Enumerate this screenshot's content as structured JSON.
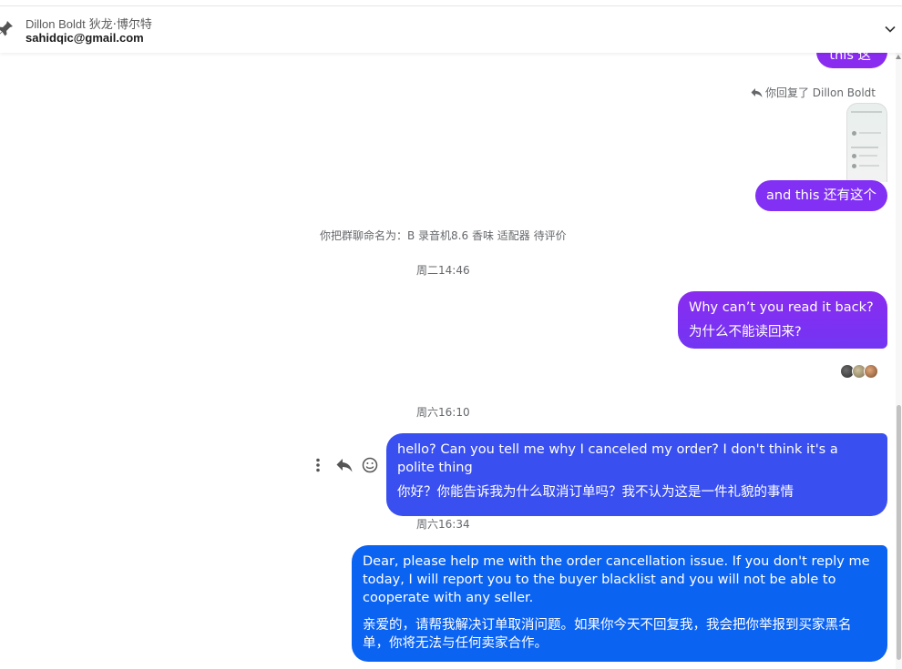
{
  "header": {
    "contact_name": "Dillon Boldt",
    "contact_name_cn": "狄龙·博尔特",
    "email": "sahidqic@gmail.com"
  },
  "thread": {
    "msg_top": "this  这",
    "reply_note": "你回复了 Dillon Boldt",
    "msg_and_this": "and this  还有这个",
    "system_rename": "你把群聊命名为：B 录音机8.6 香味 适配器 待评价",
    "ts_tue": "周二14:46",
    "msg_read_back_en": "Why can’t you read it back?",
    "msg_read_back_cn": "为什么不能读回来?",
    "ts_sat_1": "周六16:10",
    "msg_hello_en": "hello?   Can you tell me why I canceled my order? I don't think it's a polite thing",
    "msg_hello_cn": "你好？你能告诉我为什么取消订单吗？我不认为这是一件礼貌的事情",
    "ts_sat_2": "周六16:34",
    "msg_dear_en": "Dear, please help me with the order cancellation issue. If you don't reply me today, I will report you to the buyer blacklist and you will not be able to cooperate with any seller.",
    "msg_dear_cn": "亲爱的，请帮我解决订单取消问题。如果你今天不回复我，我会把你举报到买家黑名单，你将无法与任何卖家合作。"
  },
  "icons": {
    "pin": "pin-icon",
    "chevron": "chevron-down-icon",
    "reply_small": "reply-arrow-icon",
    "more": "more-vertical-icon",
    "reply": "reply-icon",
    "emoji": "emoji-icon"
  },
  "colors": {
    "bubble_purple": "#8a2cf0",
    "bubble_indigo": "#3a4ff0",
    "bubble_blue": "#0b63f2",
    "meta_text": "#65676b"
  }
}
